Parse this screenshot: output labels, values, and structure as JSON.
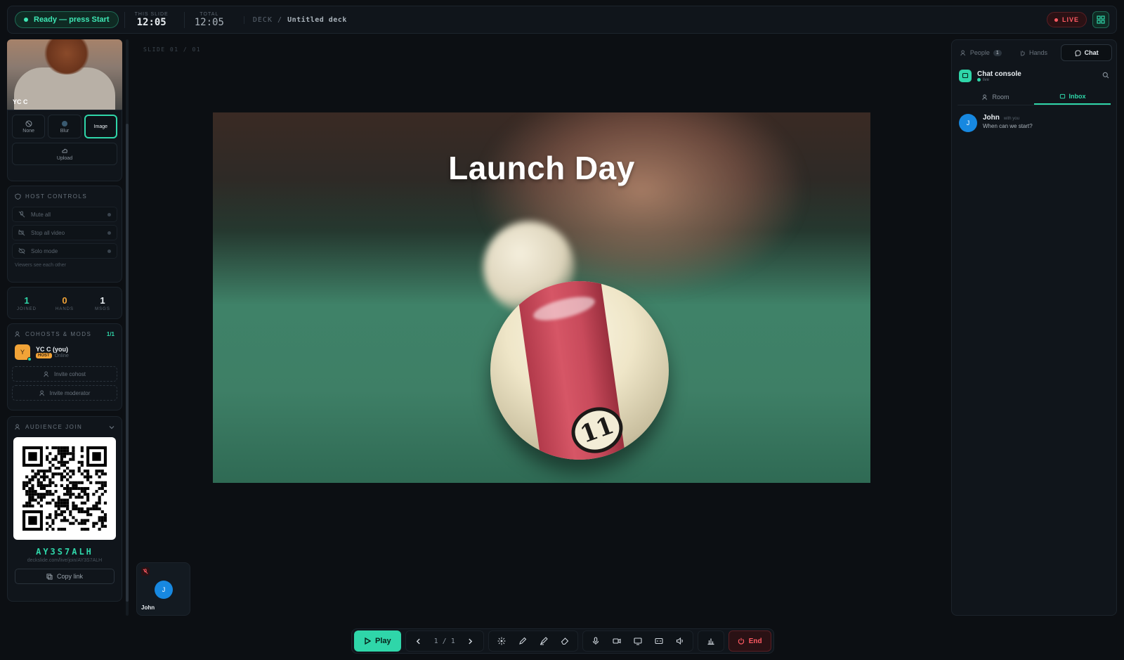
{
  "topbar": {
    "status": "Ready — press Start",
    "this_slide_label": "THIS SLIDE",
    "this_slide_time": "12:05",
    "total_label": "TOTAL",
    "total_time": "12:05",
    "deck_label": "DECK",
    "deck_sep": "/",
    "deck_name": "Untitled deck",
    "live_label": "LIVE"
  },
  "camera": {
    "name": "YC C",
    "bg_options": [
      {
        "label": "None",
        "icon": "ban-icon"
      },
      {
        "label": "Blur",
        "icon": "blur-icon"
      },
      {
        "label": "Image",
        "icon": "image-icon",
        "active": true
      }
    ],
    "upload_label": "Upload"
  },
  "host_controls": {
    "title": "HOST CONTROLS",
    "items": [
      {
        "label": "Mute all",
        "icon": "mic-off-icon"
      },
      {
        "label": "Stop all video",
        "icon": "video-off-icon"
      },
      {
        "label": "Solo mode",
        "icon": "eye-off-icon"
      }
    ],
    "hint": "Viewers see each other"
  },
  "stats": [
    {
      "value": "1",
      "label": "JOINED",
      "color": "#2fd6a9"
    },
    {
      "value": "0",
      "label": "HANDS",
      "color": "#f1a337"
    },
    {
      "value": "1",
      "label": "MSGS",
      "color": "#e8edf1"
    }
  ],
  "cohosts": {
    "title": "COHOSTS & MODS",
    "count": "1/1",
    "member": {
      "initial": "Y",
      "name": "YC C (you)",
      "role": "HOST",
      "status": "Online"
    },
    "invite_cohost": "Invite cohost",
    "invite_moderator": "Invite moderator"
  },
  "audience": {
    "title": "AUDIENCE JOIN",
    "code": "AY3S7ALH",
    "url": "deckslide.com/live/join/AY3S7ALH",
    "copy_label": "Copy link"
  },
  "stage": {
    "slide_label": "SLIDE 01 / 01",
    "slide_title": "Launch Day",
    "ball_number": "11"
  },
  "participant": {
    "initial": "J",
    "name": "John"
  },
  "toolbar": {
    "play_label": "Play",
    "page": "1 / 1",
    "end_label": "End"
  },
  "right": {
    "tabs": [
      {
        "label": "People",
        "badge": "1",
        "icon": "people-icon"
      },
      {
        "label": "Hands",
        "icon": "hand-icon"
      },
      {
        "label": "Chat",
        "icon": "chat-icon",
        "active": true
      }
    ],
    "console_title": "Chat console",
    "console_status": "live",
    "subtabs": [
      {
        "label": "Room",
        "icon": "people-icon"
      },
      {
        "label": "Inbox",
        "icon": "chat-icon",
        "active": true
      }
    ],
    "messages": [
      {
        "initial": "J",
        "name": "John",
        "meta": "with you",
        "text": "When can we start?"
      }
    ]
  },
  "colors": {
    "accent": "#2fd6a9",
    "danger": "#ff5a63",
    "host": "#f1a337",
    "avatar_blue": "#1788e0"
  }
}
